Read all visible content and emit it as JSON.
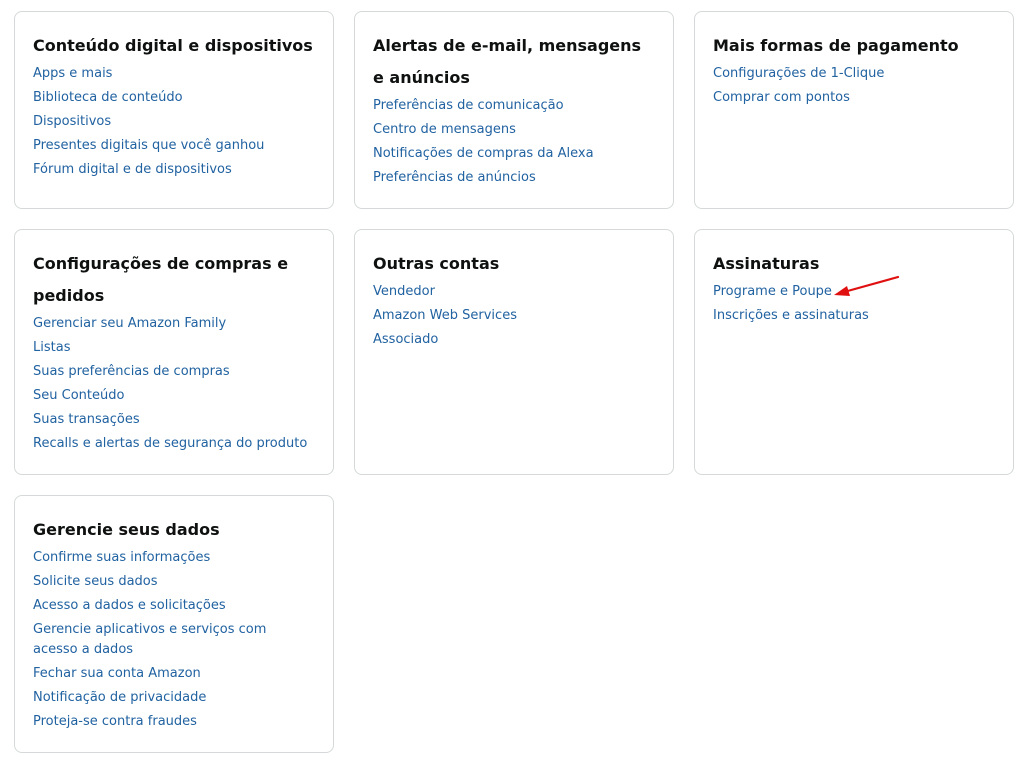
{
  "cards": [
    {
      "title": "Conteúdo digital e dispositivos",
      "links": [
        "Apps e mais",
        "Biblioteca de conteúdo",
        "Dispositivos",
        "Presentes digitais que você ganhou",
        "Fórum digital e de dispositivos"
      ]
    },
    {
      "title": "Alertas de e-mail, mensagens e anúncios",
      "links": [
        "Preferências de comunicação",
        "Centro de mensagens",
        "Notificações de compras da Alexa",
        "Preferências de anúncios"
      ]
    },
    {
      "title": "Mais formas de pagamento",
      "links": [
        "Configurações de 1-Clique",
        "Comprar com pontos"
      ]
    },
    {
      "title": "Configurações de compras e pedidos",
      "links": [
        "Gerenciar seu Amazon Family",
        "Listas",
        "Suas preferências de compras",
        "Seu Conteúdo",
        "Suas transações",
        "Recalls e alertas de segurança do produto"
      ]
    },
    {
      "title": "Outras contas",
      "links": [
        "Vendedor",
        "Amazon Web Services",
        "Associado"
      ]
    },
    {
      "title": "Assinaturas",
      "links": [
        "Programe e Poupe",
        "Inscrições e assinaturas"
      ]
    },
    {
      "title": "Gerencie seus dados",
      "links": [
        "Confirme suas informações",
        "Solicite seus dados",
        "Acesso a dados e solicitações",
        "Gerencie aplicativos e serviços com acesso a dados",
        "Fechar sua conta Amazon",
        "Notificação de privacidade",
        "Proteja-se contra fraudes"
      ]
    }
  ],
  "colors": {
    "link": "#2162a1",
    "title": "#0f1111",
    "border": "#d5d9d9",
    "annotation_arrow": "#e01010"
  }
}
